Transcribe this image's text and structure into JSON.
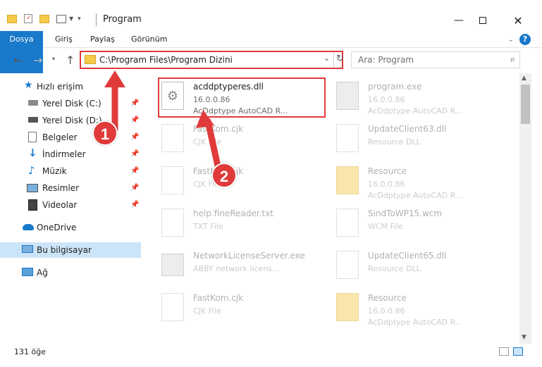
{
  "window": {
    "title": "Program",
    "minimize_icon": "minimize-icon",
    "maximize_icon": "maximize-icon",
    "close_icon": "close-icon"
  },
  "ribbon": {
    "tabs": [
      {
        "label": "Dosya"
      },
      {
        "label": "Giriş"
      },
      {
        "label": "Paylaş"
      },
      {
        "label": "Görünüm"
      }
    ]
  },
  "nav": {
    "address": "C:\\Program Files\\Program Dizini",
    "search_placeholder": "Ara: Program"
  },
  "sidebar": {
    "items": [
      {
        "label": "Hızlı erişim",
        "icon": "star-icon"
      },
      {
        "label": "Yerel Disk (C:)",
        "icon": "drive-icon"
      },
      {
        "label": "Yerel Disk (D:)",
        "icon": "drive-icon"
      },
      {
        "label": "Belgeler",
        "icon": "documents-icon"
      },
      {
        "label": "İndirmeler",
        "icon": "downloads-icon"
      },
      {
        "label": "Müzik",
        "icon": "music-icon"
      },
      {
        "label": "Resimler",
        "icon": "pictures-icon"
      },
      {
        "label": "Videolar",
        "icon": "videos-icon"
      },
      {
        "label": "OneDrive",
        "icon": "cloud-icon"
      },
      {
        "label": "Bu bilgisayar",
        "icon": "computer-icon"
      },
      {
        "label": "Ağ",
        "icon": "network-icon"
      }
    ]
  },
  "files": [
    {
      "name": "acddptyperes.dll",
      "line2": "16.0.0.86",
      "line3": "AcDdptype AutoCAD R...",
      "icon": "dll-icon"
    },
    {
      "name": "program.exe",
      "line2": "16.0.0.86",
      "line3": "AcDdptype AutoCAD R...",
      "icon": "exe-icon"
    },
    {
      "name": "FastKom.cjk",
      "line2": "CJK File",
      "line3": "",
      "icon": "file-icon"
    },
    {
      "name": "UpdateClient63.dll",
      "line2": "Resource DLL",
      "line3": "",
      "icon": "dll-icon"
    },
    {
      "name": "FastKom.cjk",
      "line2": "CJK File",
      "line3": "",
      "icon": "file-icon"
    },
    {
      "name": "Resource",
      "line2": "16.0.0.86",
      "line3": "AcDdptype AutoCAD R...",
      "icon": "folder-icon"
    },
    {
      "name": "help.fineReader.txt",
      "line2": "TXT File",
      "line3": "",
      "icon": "text-file-icon"
    },
    {
      "name": "SindToWP15.wcm",
      "line2": "WCM File",
      "line3": "",
      "icon": "file-icon"
    },
    {
      "name": "NetworkLicenseServer.exe",
      "line2": "ABBY network licens...",
      "line3": "",
      "icon": "exe-icon"
    },
    {
      "name": "UpdateClient65.dll",
      "line2": "Resource DLL",
      "line3": "",
      "icon": "dll-icon"
    },
    {
      "name": "FastKom.cjk",
      "line2": "CJK File",
      "line3": "",
      "icon": "file-icon"
    },
    {
      "name": "Resource",
      "line2": "16.0.0.86",
      "line3": "AcDdptype AutoCAD R...",
      "icon": "folder-icon"
    }
  ],
  "status": {
    "count": "131 öğe"
  },
  "annotations": {
    "step1": "1",
    "step2": "2",
    "color": "#e03a3a"
  },
  "colors": {
    "accent": "#1979ca",
    "selection": "#cce4f7"
  }
}
